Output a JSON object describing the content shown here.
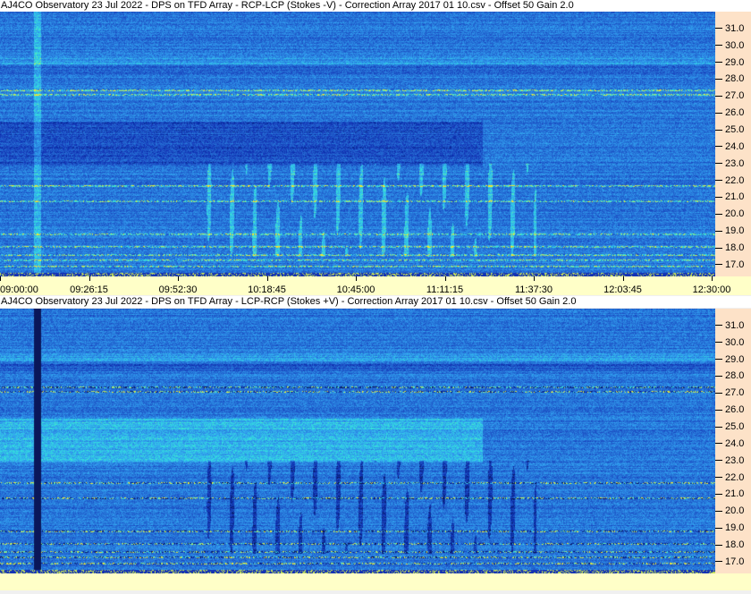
{
  "chart_data": [
    {
      "type": "heatmap",
      "title": "AJ4CO Observatory 23 Jul 2022  -  DPS on TFD Array  -  RCP-LCP (Stokes -V)  -  Correction Array 2017 01 10.csv  -  Offset 50  Gain 2.0",
      "x_ticks": [
        "09:00:00",
        "09:26:15",
        "09:52:30",
        "10:18:45",
        "10:45:00",
        "11:11:15",
        "11:37:30",
        "12:03:45",
        "12:30:00"
      ],
      "y_ticks": [
        "31.0",
        "30.0",
        "29.0",
        "28.0",
        "27.0",
        "26.0",
        "25.0",
        "24.0",
        "23.0",
        "22.0",
        "21.0",
        "20.0",
        "19.0",
        "18.0",
        "17.0"
      ],
      "ylim": [
        16.3,
        32.0
      ],
      "colormap": [
        "#0a1a60",
        "#1e4fd8",
        "#2f7cf0",
        "#38d0e8",
        "#f0f040",
        "#ff4040"
      ]
    },
    {
      "type": "heatmap",
      "title": "AJ4CO Observatory 23 Jul 2022  -  DPS on TFD Array  -  LCP-RCP (Stokes +V)  -  Correction Array 2017 01 10.csv  -  Offset 50  Gain 2.0",
      "y_ticks": [
        "31.0",
        "30.0",
        "29.0",
        "28.0",
        "27.0",
        "26.0",
        "25.0",
        "24.0",
        "23.0",
        "22.0",
        "21.0",
        "20.0",
        "19.0",
        "18.0",
        "17.0"
      ],
      "ylim": [
        16.3,
        32.0
      ]
    }
  ],
  "colors": {
    "title_bg": "#ffffff",
    "yaxis_bg": "#fde2c8",
    "xaxis_bg": "#ffffc8"
  }
}
